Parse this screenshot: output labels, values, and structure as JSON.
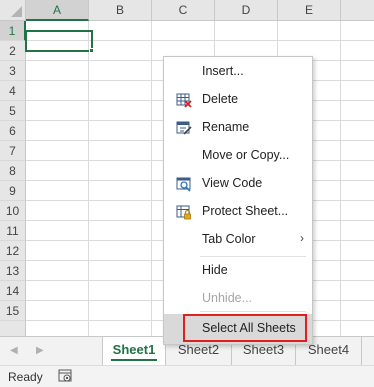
{
  "sheet": {
    "columns": [
      "A",
      "B",
      "C",
      "D",
      "E"
    ],
    "rows": [
      "1",
      "2",
      "3",
      "4",
      "5",
      "6",
      "7",
      "8",
      "9",
      "10",
      "11",
      "12",
      "13",
      "14",
      "15"
    ],
    "active_column": "A",
    "active_row": "1"
  },
  "tabs": {
    "items": [
      "Sheet1",
      "Sheet2",
      "Sheet3",
      "Sheet4"
    ],
    "active": "Sheet1",
    "nav_prev": "◀",
    "nav_next": "▶"
  },
  "status": {
    "text": "Ready",
    "macro_icon": "macro-record-icon"
  },
  "context_menu": {
    "insert": "Insert...",
    "delete": "Delete",
    "rename": "Rename",
    "move_copy": "Move or Copy...",
    "view_code": "View Code",
    "protect_sheet": "Protect Sheet...",
    "tab_color": "Tab Color",
    "tab_color_arrow": "›",
    "hide": "Hide",
    "unhide": "Unhide...",
    "select_all_sheets": "Select All Sheets"
  },
  "colors": {
    "accent": "#217346",
    "highlight_outline": "#e0201f"
  }
}
